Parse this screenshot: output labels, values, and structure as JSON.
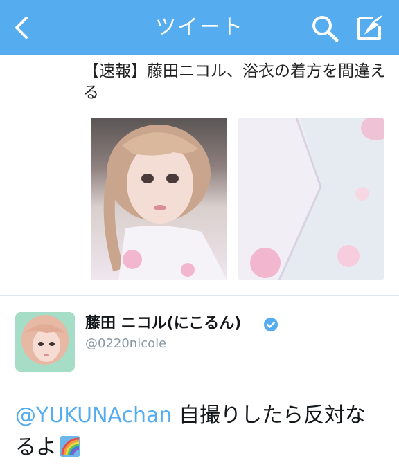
{
  "navbar": {
    "title": "ツイート",
    "back_icon": "chevron-left-icon",
    "search_icon": "search-icon",
    "compose_icon": "compose-icon",
    "background_color": "#55acee"
  },
  "quoted_tweet": {
    "text": "【速報】藤田ニコル、浴衣の着方を間違える",
    "media": [
      {
        "description_icon": "photo-selfie"
      },
      {
        "description_icon": "photo-yukata-closeup"
      }
    ]
  },
  "tweet": {
    "display_name": "藤田 ニコル(にこるん)",
    "handle": "@0220nicole",
    "verified_icon": "verified-badge-icon",
    "mention": "@YUKUNAchan",
    "text": " 自撮りしたら反対なるよ",
    "emoji_icon": "rainbow-emoji-icon",
    "mention_color": "#55acee"
  }
}
